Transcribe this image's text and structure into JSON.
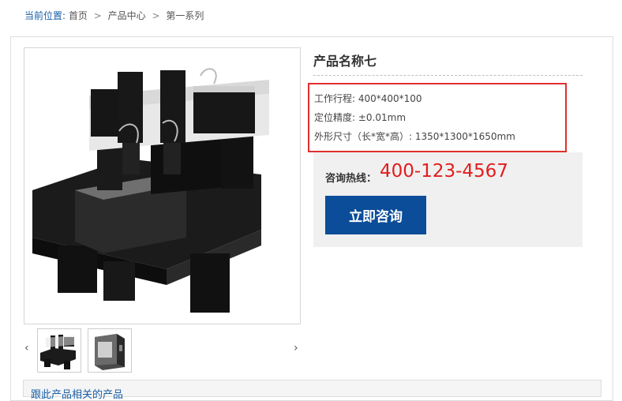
{
  "breadcrumb": {
    "lead": "当前位置:",
    "items": [
      "首页",
      "产品中心",
      "第一系列"
    ],
    "separator": ">"
  },
  "product": {
    "title": "产品名称七",
    "specs": [
      "工作行程: 400*400*100",
      "定位精度: ±0.01mm",
      "外形尺寸（长*宽*高）: 1350*1300*1650mm"
    ]
  },
  "contact": {
    "hotline_label": "咨询热线：",
    "hotline_number": "400-123-4567",
    "consult_button": "立即咨询"
  },
  "gallery": {
    "prev_icon": "‹",
    "next_icon": "›"
  },
  "related": {
    "label": "跟此产品相关的产品"
  },
  "colors": {
    "accent_blue": "#0b4d99",
    "hotline_red": "#e21d1d",
    "highlight_border": "#e0302f"
  }
}
